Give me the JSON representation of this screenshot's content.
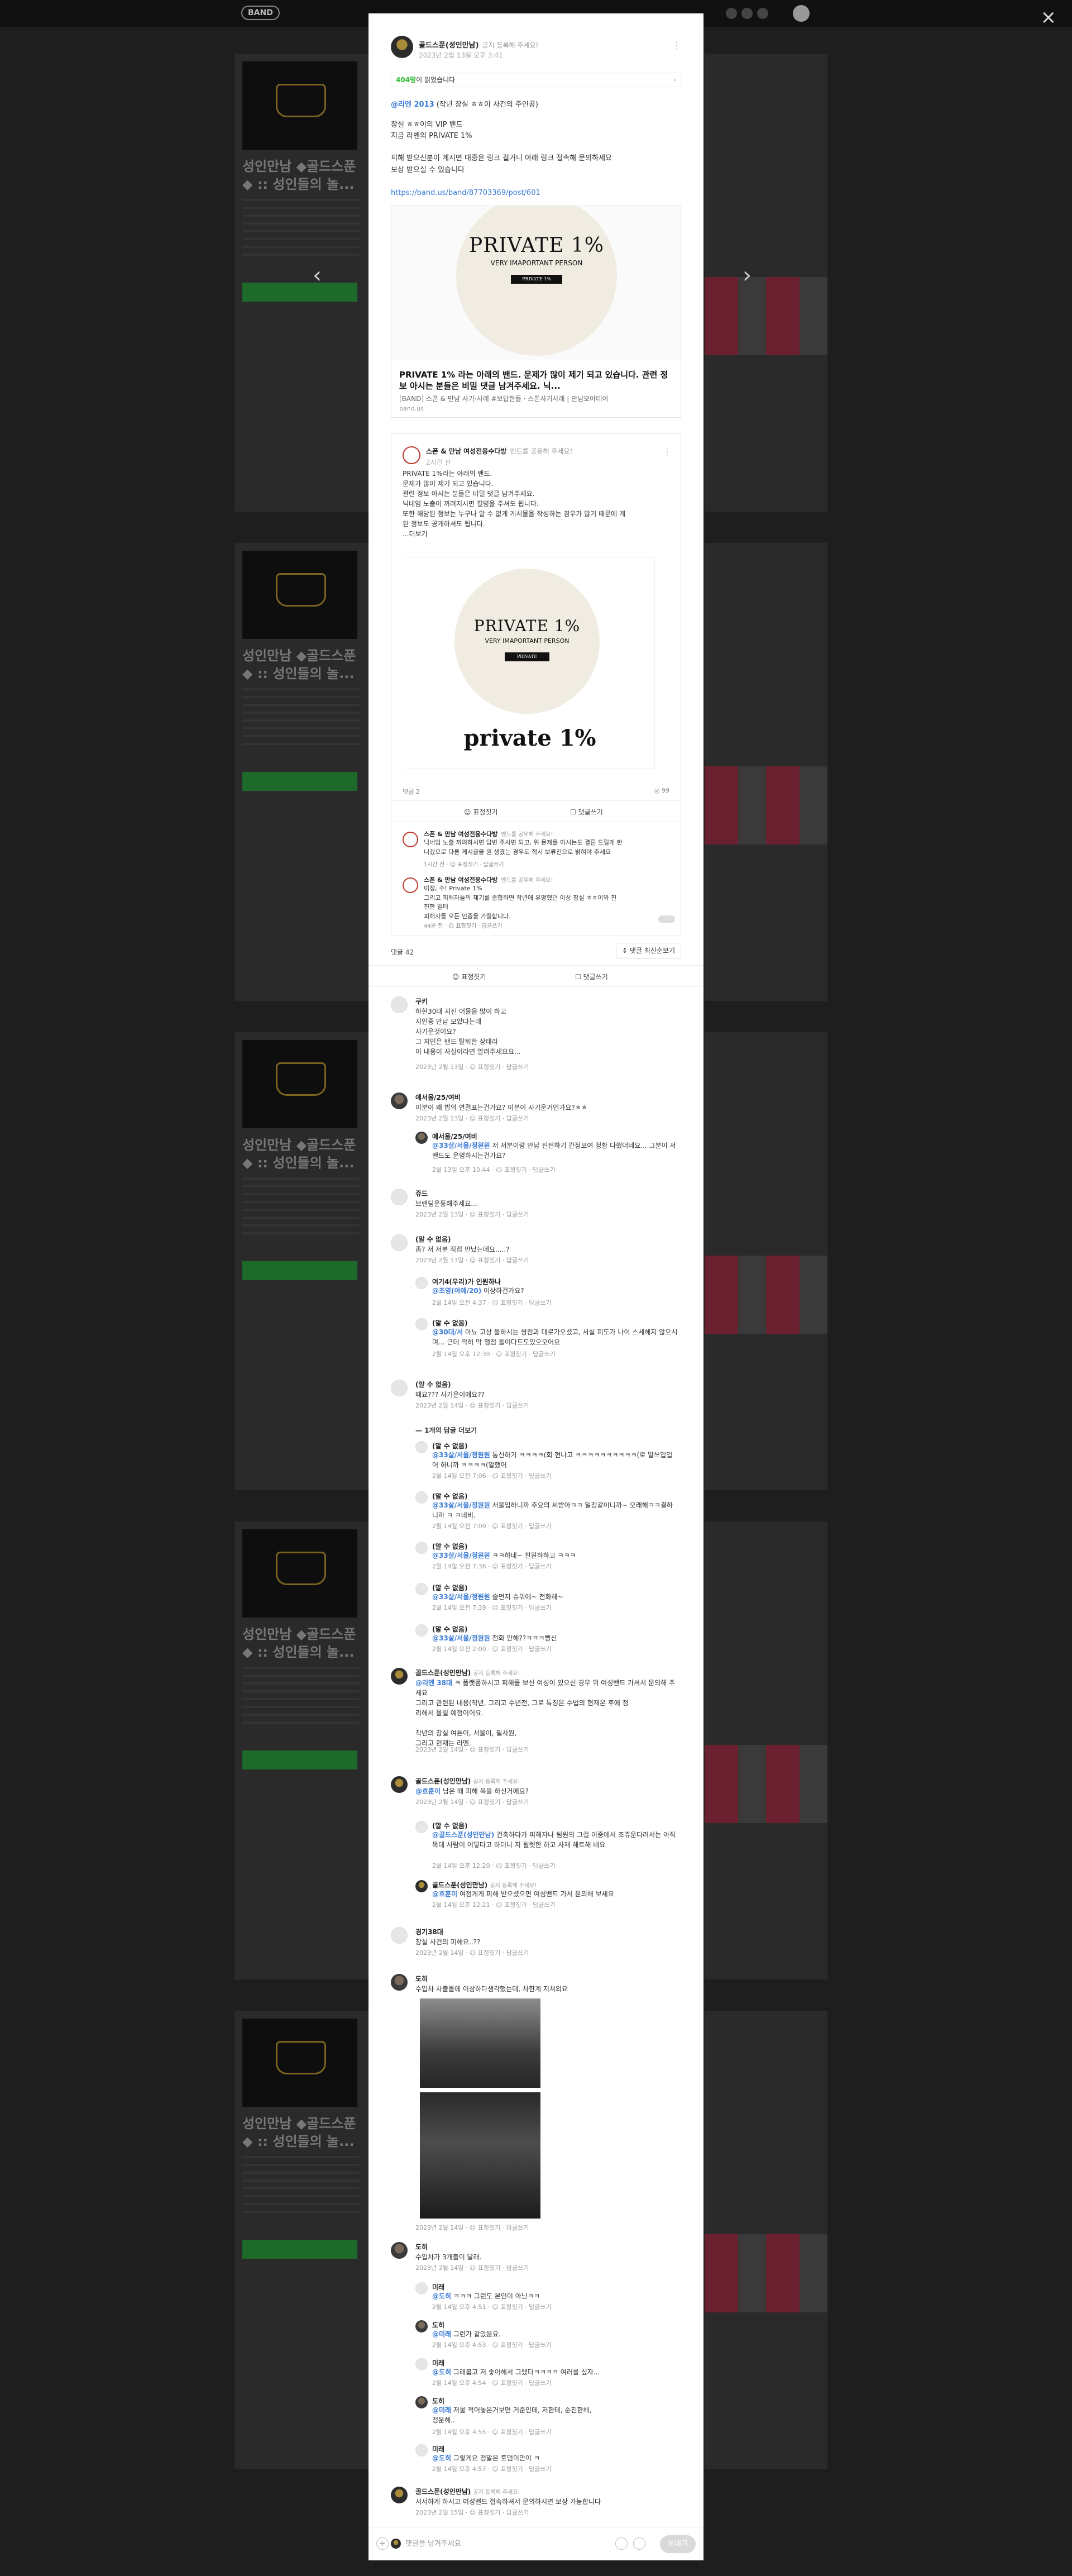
{
  "app": {
    "logo": "BAND",
    "close": "×"
  },
  "background": {
    "card_title": "성인만남 ◆골드스푼◆ :: 성인들의 놀...",
    "nav_prev": "‹",
    "nav_next": "›"
  },
  "post": {
    "author": "골드스푼(성인만남)",
    "author_sub": "공지 등록해 주세요!",
    "date": "2023년 2월 13일 오후 3:41",
    "read_count": "404명",
    "read_suffix": "이 읽었습니다",
    "tag": "@리엔 2013",
    "tag_suffix": " (작년 창실 ㅎㅎ이 사건의 주인공)",
    "body": "창실 ㅎㅎ이의 VIP 밴드\n지금 라벤의 PRIVATE 1%\n\n피해 받으신분이 계시면 대중은 링크 걸거니 아래 링크 접속해 문의하세요\n보상 받으실 수 있습니다",
    "link": "https://band.us/band/87703369/post/601",
    "link_card": {
      "logo_big": "PRIVATE 1%",
      "logo_small": "VERY IMAPORTANT PERSON",
      "logo_pill": "PRIVATE 1%",
      "title": "PRIVATE 1% 라는 아래의 밴드. 문제가 많이 제기 되고 있습니다. 관련 정보 아시는 분들은 비밀 댓글 남겨주세요. 닉...",
      "desc": "[BAND] 스폰 & 만남 사기·사례 #보답한들 · 스폰사기사례 | 만남모아테이",
      "domain": "band.us"
    },
    "shared": {
      "author": "스폰 & 만남 여성전용수다방",
      "author_sub": "밴드를 공유해 주세요!",
      "date": "2시간 전",
      "text": "PRIVATE 1%라는 아래의 밴드.\n문제가 많이 제기 되고 있습니다.\n관련 정보 아시는 분들은 비밀 댓글 남겨주세요.\n닉네임 노출이 꺼려지시면 필명을 주셔도 됩니다.\n또한 해당된 정보는 누구나 알 수 없게 게시물을 작성하는 경우가 많기 때문에 게\n된 정보도 공개하셔도 됩니다.\n...더보기",
      "logo_big": "PRIVATE 1%",
      "logo_small": "VERY IMAPORTANT PERSON",
      "logo_pill": "PRIVATE",
      "private_text": "private 1%",
      "comments_label": "댓글 2",
      "views_label": "◎ 99",
      "like_label": "☺ 표정짓기",
      "comment_label": "☐ 댓글쓰기",
      "c1_name": "스폰 & 만남 여성전용수다방",
      "c1_sub": "밴드를 공유해 주세요!",
      "c1_text": "닉네임 노출 꺼려하시면 답변 주시면 되고, 위 문제를 아시는도 결론 드릴게 한\n니겠으로 다른 게시글을 원 생겼는 경우도 적시 보류진으로 밝혀야 주세요",
      "c1_meta": "1시간 전 · ☺ 표정짓기 · 답글쓰기",
      "c2_name": "스폰 & 만남 여성전용수다방",
      "c2_sub": "밴드를 공유해 주세요!",
      "c2_text": "이정, 수! Private 1%\n그리고 피해자들의 제기를 종합하면 작년에 유명했던 이상 창실 ㅎㅎ이와 친\n친한 밀터\n피해자들 모든 인증을 가질합니다.",
      "c2_meta": "44분 전 · ☺ 표정짓기 · 답글쓰기",
      "more_btn": "···"
    },
    "comment_count": "댓글 42",
    "sort": "↕ 댓글 최신순보기",
    "like": "☺ 표정짓기",
    "write": "☐ 댓글쓰기"
  },
  "comments": [
    {
      "name": "쿠키",
      "text": "하현30대 지신 어울을 많이 하고\n지인중 만남 모았다는데\n사기운것이요?\n그 지인은 밴드 탈퇴한 상태라\n이 내용이 사실이라면 알려주세요요...",
      "meta": "2023년 2월 13일 · ☺ 표정짓기 · 답글쓰기"
    },
    {
      "name": "예서울/25/여비",
      "text": "이분이 왜 밥의 연결표는건가요? 이분이 사기운거인가요?ㅎㅎ",
      "meta": "2023년 2월 13일 · ☺ 표정짓기 · 답글쓰기"
    },
    {
      "name": "예서울/25/여비",
      "tag": "@33살/서울/정원원",
      "text": " 저 저분이랑 만남 진전하기 간정보여 정황 다했더네요... 그분이 저 밴드도 운영하시는건가요?",
      "meta": "2월 13일 오후 10:44 · ☺ 표정짓기 · 답글쓰기"
    },
    {
      "name": "쥬드",
      "text": "브랜딩운동해주세요...",
      "meta": "2023년 2월 13일 · ☺ 표정짓기 · 답글쓰기"
    },
    {
      "name": "(알 수 없음)",
      "text": "좀? 저 저분 직접 만났는데요.....?",
      "meta": "2023년 2월 13일 · ☺ 표정짓기 · 답글쓰기"
    },
    {
      "name": "여기4(우리)가 인원하나",
      "tag": "@조영(아예/20)",
      "text": " 이상하건가요?",
      "meta": "2월 14일 오전 4:37 · ☺ 표정짓기 · 답글쓰기"
    },
    {
      "name": "(알 수 없음)",
      "tag": "@30대/서",
      "text": " 아뇨 고상 돌하시는 쌍점과 대로가오셨고, 서실 피도가 나이 스세해지 않으시며... 근데 딱히 막 쟁점 돌이다드도있으오어요",
      "meta": "2월 14일 오후 12:30 · ☺ 표정짓기 · 답글쓰기"
    },
    {
      "name": "(알 수 없음)",
      "text": "때요??? 사기운이에요??",
      "meta": "2023년 2월 14일 · ☺ 표정짓기 · 답글쓰기"
    },
    {
      "reply_toggle": "— 1개의 답글 더보기"
    },
    {
      "name": "(알 수 없음)",
      "tag": "@33살/서울/정원원",
      "text": " 통신하기 ㅋㅋㅋㅋ(회 현나고 ㅋㅋㅋㅋㅋㅋㅋㅋㅋㅋ(로 말쓰입입어 하니까 ㅋㅋㅋㅋ(알했어",
      "meta": "2월 14일 오전 7:06 · ☺ 표정짓기 · 답글쓰기"
    },
    {
      "name": "(알 수 없음)",
      "tag": "@33살/서울/정원원",
      "text": " 서울입하니까 주요의 씨받아ㅋㅋ 일정같이니까~ 오래해ㅋㅋ결하니까 ㅋ ㅋ네비.",
      "meta": "2월 14일 오전 7:09 · ☺ 표정짓기 · 답글쓰기"
    },
    {
      "name": "(알 수 없음)",
      "tag": "@33살/서울/정원원",
      "text": " ㅋㅋ하네~ 친원하하고 ㅋㅋㅋ",
      "meta": "2월 14일 오전 7:36 · ☺ 표정짓기 · 답글쓰기"
    },
    {
      "name": "(알 수 없음)",
      "tag": "@33살/서울/정원원",
      "text": " 술먼지 슈워에~ 전화해~",
      "meta": "2월 14일 오전 7:39 · ☺ 표정짓기 · 답글쓰기"
    },
    {
      "name": "(알 수 없음)",
      "tag": "@33살/서울/정원원",
      "text": " 전화 안해??ㅋㅋㅋ빵신",
      "meta": "2월 14일 오전 2:00 · ☺ 표정짓기 · 답글쓰기"
    },
    {
      "name": "골드스푼(성인만남)",
      "sub": "공지 등록해 주세요!",
      "tag": "@리엔 38대",
      "text": " ㅋ 플랫폼하시고 피해를 보신 여성이 있으신 경우 위 여성밴드 가셔서 문의해 주세요\n그리고 관련된 내용(작년, 그리고 수년전, 그로 특징은 수법의 현재온 후에 정\n리해서 올릴 예정이어요.\n\n작년의 창실 여튼이, 서울이, 필사원,\n그리고 현재는 라멘.",
      "meta": "2023년 2월 14일 · ☺ 표정짓기 · 답글쓰기"
    },
    {
      "name": "골드스푼(성인만남)",
      "sub": "공지 등록해 주세요!",
      "tag": "@흐훈이",
      "text": " 남은 때 피해 목을 하신거에요?",
      "meta": "2023년 2월 14일 · ☺ 표정짓기 · 답글쓰기"
    },
    {
      "name": "(알 수 없음)",
      "tag": "@골드스푼(성인만남)",
      "text": " 건축하다가 피해자나 팀원의 그걸 이중에서 조쥬운다려서는 아직목데 사람이 어떻다고 하더니 지 될렛한 하고 사재 해트해 네요",
      "meta": "2월 14일 오후 12:20 · ☺ 표정짓기 · 답글쓰기"
    },
    {
      "name": "골드스푼(성인만남)",
      "sub": "공지 등록해 주세요!",
      "tag": "@흐훈이",
      "text": " 여정게게 피해 받으셨으면 여성밴드 가서 문의해 보세요",
      "meta": "2월 14일 오후 12:21 · ☺ 표정짓기 · 답글쓰기"
    },
    {
      "name": "경기38대",
      "text": "창실 사건의 피해요..??",
      "meta": "2023년 2월 14일 · ☺ 표정짓기 · 답글쓰기"
    },
    {
      "name": "도히",
      "text": "수입차 차출돌에 이상하다생각했는데, 차한계 지쳐외요",
      "meta": "2023년 2월 14일 · ☺ 표정짓기 · 답글쓰기"
    },
    {
      "name": "도히",
      "text": "수입차가 3개출이 달래.",
      "meta": "2023년 2월 14일 · ☺ 표정짓기 · 답글쓰기"
    },
    {
      "name": "미래",
      "tag": "@도히",
      "text": " ㅋㅋㅋ 그런도 본인이 아닌ㅋㅋ",
      "meta": "2월 14일 오후 4:51 · ☺ 표정짓기 · 답글쓰기"
    },
    {
      "name": "도히",
      "tag": "@미래",
      "text": " 그런가 같았음요.",
      "meta": "2월 14일 오후 4:53 · ☺ 표정짓기 · 답글쓰기"
    },
    {
      "name": "미래",
      "tag": "@도히",
      "text": " 그래봅고 저 좋아해서 그랬다ㅋㅋㅋㅋ 여러를 싶자...",
      "meta": "2월 14일 오후 4:54 · ☺ 표정짓기 · 답글쓰기"
    },
    {
      "name": "도히",
      "tag": "@미래",
      "text": " 저물 적어놓은거보면 거준인데, 저한테, 순진한해,\n정운해..",
      "meta": "2월 14일 오후 4:55 · ☺ 표정짓기 · 답글쓰기"
    },
    {
      "name": "미래",
      "tag": "@도히",
      "text": " 그렇게요 정말은 토멈이만이 ㅋ",
      "meta": "2월 14일 오후 4:57 · ☺ 표정짓기 · 답글쓰기"
    },
    {
      "name": "골드스푼(성인만남)",
      "sub": "공지 등록해 주세요!",
      "text": "서서하게 하시고 여성밴드 접속하셔서 문의하시면 보상 가능합니다",
      "meta": "2023년 2월 15일 · ☺ 표정짓기 · 답글쓰기"
    }
  ],
  "input": {
    "placeholder": "댓글을 남겨주세요",
    "send": "보내기",
    "plus": "+"
  }
}
